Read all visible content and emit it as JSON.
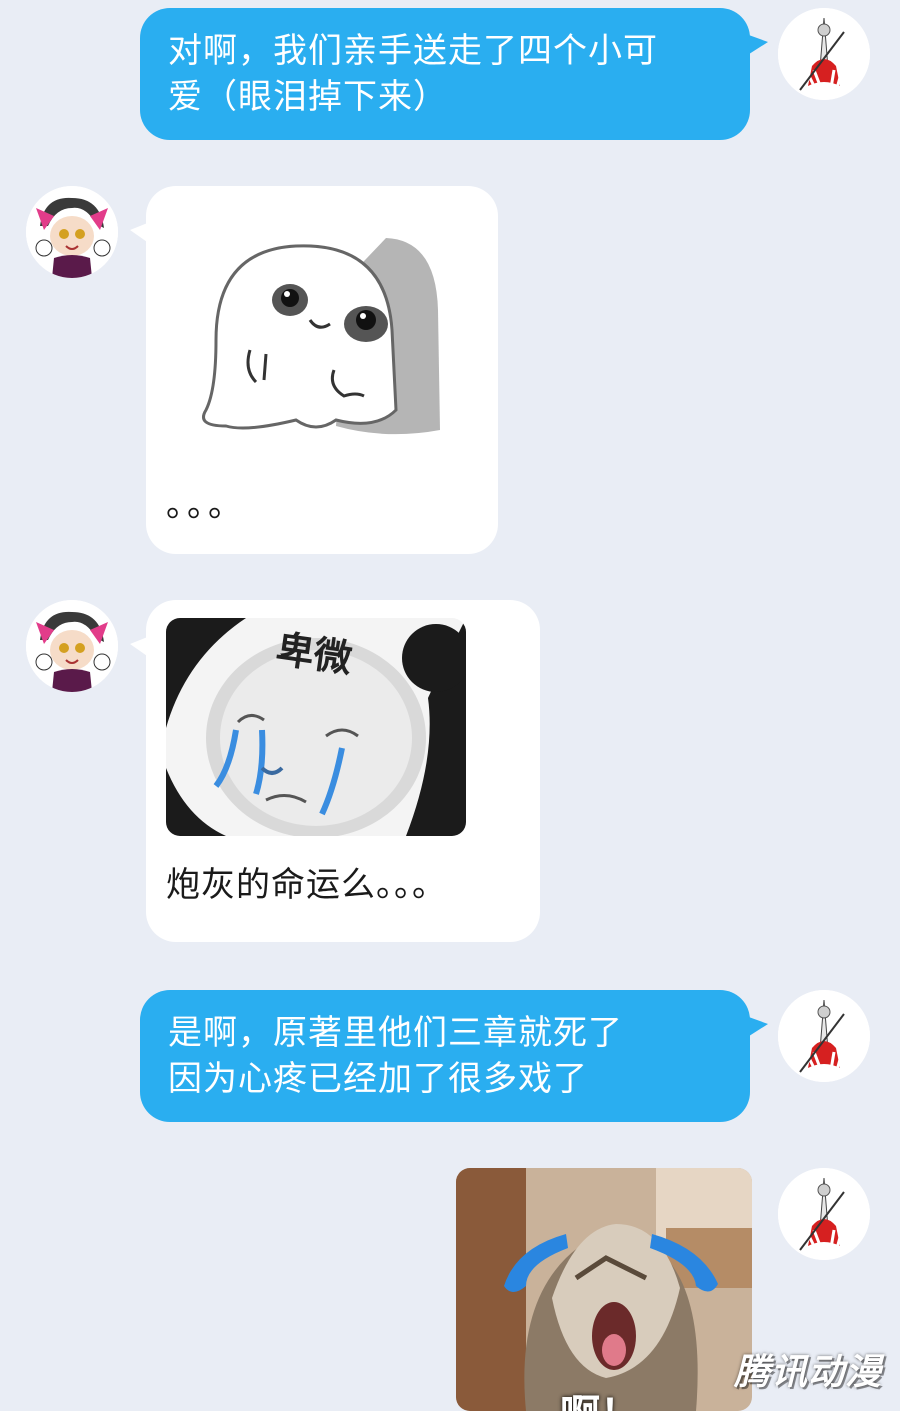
{
  "messages": [
    {
      "id": 1,
      "sender": "me",
      "text": "对啊，我们亲手送走了四个小可\n爱（眼泪掉下来）"
    },
    {
      "id": 2,
      "sender": "other",
      "sticker": "ghost-peeking-sticker",
      "text": "。。。"
    },
    {
      "id": 3,
      "sender": "other",
      "sticker": "crying-panda-sticker",
      "sticker_caption": "卑微",
      "text": "炮灰的命运么。。。"
    },
    {
      "id": 4,
      "sender": "me",
      "text": "是啊，原著里他们三章就死了\n因为心疼已经加了很多戏了"
    },
    {
      "id": 5,
      "sender": "me",
      "sticker": "crying-cat-sticker",
      "sticker_caption": "啊！"
    }
  ],
  "watermark": "腾讯动漫",
  "colors": {
    "background": "#e9edf5",
    "outgoing_bubble": "#2aaef0",
    "incoming_bubble": "#ffffff"
  }
}
